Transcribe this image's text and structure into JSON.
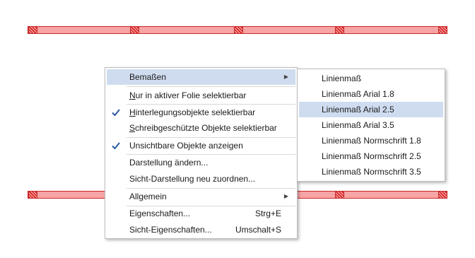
{
  "context_menu": {
    "items": [
      {
        "label": "Bemaßen",
        "submenu": true,
        "highlighted": true
      },
      {
        "label_u": "N",
        "label_rest": "ur in aktiver Folie selektierbar"
      },
      {
        "label_u": "H",
        "label_rest": "interlegungsobjekte selektierbar",
        "checked": true
      },
      {
        "label_u": "S",
        "label_rest": "chreibgeschützte Objekte selektierbar"
      },
      {
        "label": "Unsichtbare Objekte anzeigen",
        "checked": true
      },
      {
        "label": "Darstellung ändern..."
      },
      {
        "label": "Sicht-Darstellung neu zuordnen..."
      },
      {
        "label": "Allgemein",
        "submenu": true
      },
      {
        "label": "Eigenschaften...",
        "shortcut": "Strg+E"
      },
      {
        "label": "Sicht-Eigenschaften...",
        "shortcut": "Umschalt+S"
      }
    ]
  },
  "submenu": {
    "items": [
      {
        "label": "Linienmaß"
      },
      {
        "label": "Linienmaß Arial 1.8"
      },
      {
        "label": "Linienmaß Arial 2.5",
        "highlighted": true
      },
      {
        "label": "Linienmaß Arial 3.5"
      },
      {
        "label": "Linienmaß Normschrift 1.8"
      },
      {
        "label": "Linienmaß Normschrift 2.5"
      },
      {
        "label": "Linienmaß Normschrift 3.5"
      }
    ]
  },
  "icons": {
    "check": "check-icon",
    "submenu_arrow": "chevron-right-icon"
  },
  "colors": {
    "highlight": "#cfdcef",
    "check": "#2a5aa0",
    "wall_fill": "#f7a4a4",
    "wall_stroke": "#c62828"
  }
}
